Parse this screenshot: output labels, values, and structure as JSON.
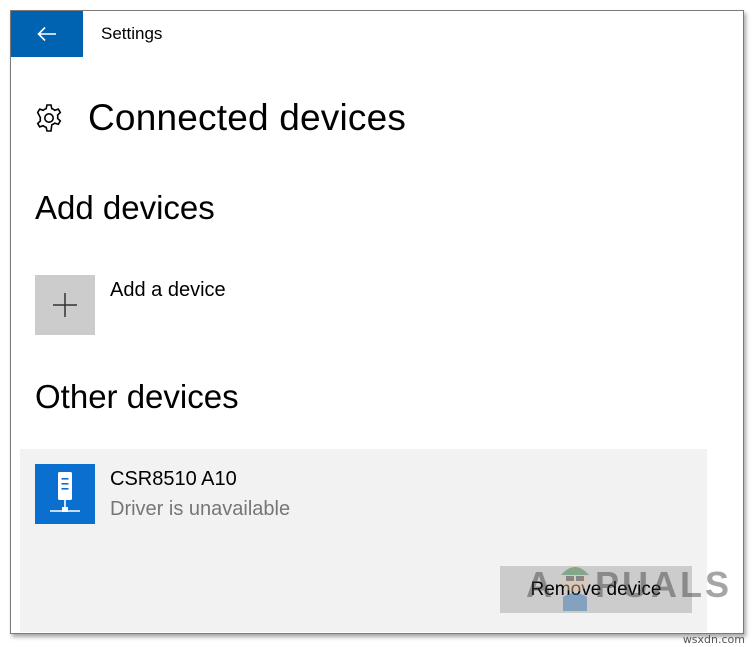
{
  "window": {
    "app_title": "Settings",
    "back_icon": "arrow-left-icon"
  },
  "header": {
    "icon": "gear-icon",
    "title": "Connected devices"
  },
  "add_devices": {
    "heading": "Add devices",
    "add_label": "Add a device",
    "add_icon": "plus-icon"
  },
  "other_devices": {
    "heading": "Other devices",
    "devices": [
      {
        "name": "CSR8510 A10",
        "status": "Driver is unavailable",
        "icon": "usb-device-icon",
        "action_label": "Remove device"
      }
    ]
  },
  "watermark": {
    "text_left": "A",
    "text_right": "PUALS"
  },
  "site_mark": "wsxdn.com",
  "colors": {
    "accent": "#0063b1",
    "device_icon_bg": "#0a6fcf",
    "tile_gray": "#cccccc",
    "panel_bg": "#f2f2f2",
    "secondary_text": "#767676"
  }
}
